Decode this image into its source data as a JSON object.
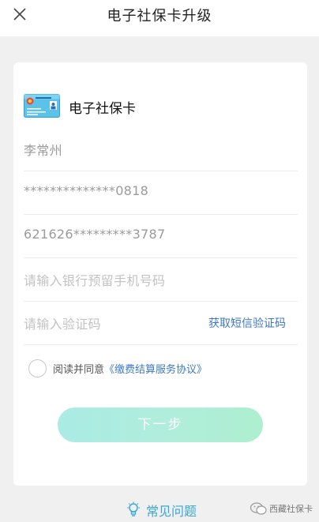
{
  "header": {
    "title": "电子社保卡升级"
  },
  "card": {
    "title": "电子社保卡",
    "name": "李常州",
    "id_number": "**************0818",
    "card_number": "621626*********3787",
    "phone_placeholder": "请输入银行预留手机号码",
    "code_placeholder": "请输入验证码",
    "get_code_label": "获取短信验证码"
  },
  "agreement": {
    "prefix": "阅读并同意",
    "link": "《缴费结算服务协议》",
    "checked": false
  },
  "next_button": {
    "label": "下一步"
  },
  "footer": {
    "faq_label": "常见问题",
    "watermark": "西藏社保卡"
  },
  "colors": {
    "link": "#3d78c8",
    "faq": "#3aa7d4",
    "button_gradient_start": "#a9ece4",
    "button_gradient_end": "#aeefd0"
  }
}
